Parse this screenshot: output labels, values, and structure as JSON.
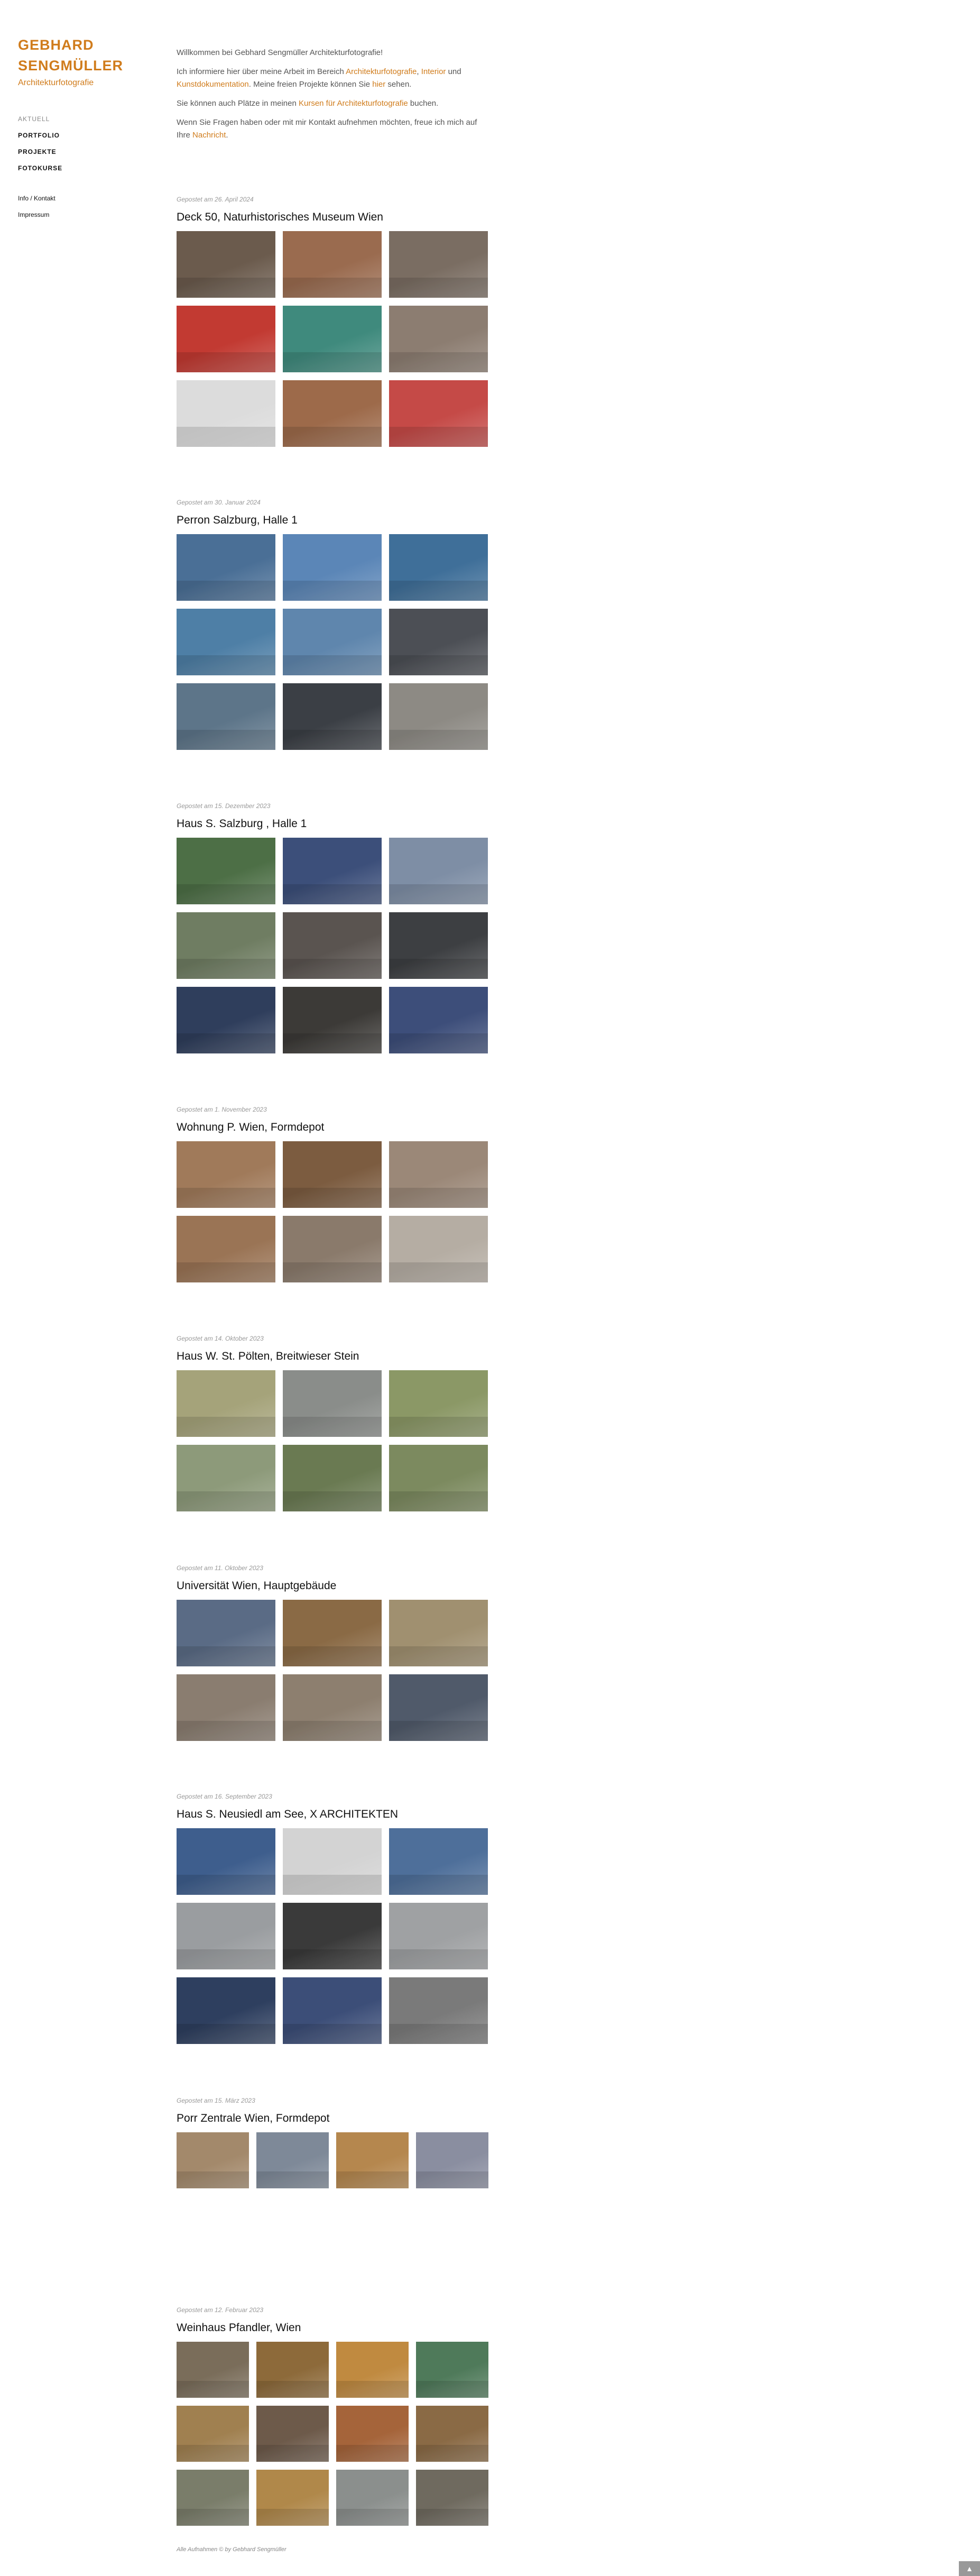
{
  "sidebar": {
    "logo_line1": "GEBHARD",
    "logo_line2": "SENGMÜLLER",
    "subtitle": "Architekturfotografie",
    "nav": [
      "AKTUELL",
      "PORTFOLIO",
      "PROJEKTE",
      "FOTOKURSE"
    ],
    "nav2": [
      "Info / Kontakt",
      "Impressum"
    ]
  },
  "intro": {
    "p1": "Willkommen bei Gebhard Sengmüller Architekturfotografie!",
    "p2_a": "Ich informiere hier über meine Arbeit im Bereich ",
    "p2_link1": "Architekturfotografie",
    "p2_b": ", ",
    "p2_link2": "Interior",
    "p2_c": " und ",
    "p2_link3": "Kunstdokumentation",
    "p2_d": ". Meine freien Projekte können Sie ",
    "p2_link4": "hier",
    "p2_e": " sehen.",
    "p3_a": "Sie können auch Plätze in meinen ",
    "p3_link": "Kursen für Architekturfotografie",
    "p3_b": " buchen.",
    "p4_a": "Wenn Sie Fragen haben oder mit mir Kontakt aufnehmen möchten, freue ich mich auf Ihre ",
    "p4_link": "Nachricht",
    "p4_b": "."
  },
  "posts": [
    {
      "date": "Gepostet am 26. April 2024",
      "title": "Deck 50, Naturhistorisches Museum Wien"
    },
    {
      "date": "Gepostet am 30. Januar 2024",
      "title": "Perron Salzburg, Halle 1"
    },
    {
      "date": "Gepostet am 15. Dezember 2023",
      "title": "Haus S. Salzburg , Halle 1"
    },
    {
      "date": "Gepostet am 1. November 2023",
      "title": "Wohnung P. Wien, Formdepot"
    },
    {
      "date": "Gepostet am 14. Oktober 2023",
      "title": "Haus W. St. Pölten, Breitwieser Stein"
    },
    {
      "date": "Gepostet am 11. Oktober 2023",
      "title": "Universität Wien, Hauptgebäude"
    },
    {
      "date": "Gepostet am 16. September 2023",
      "title": "Haus S. Neusiedl am See, X ARCHITEKTEN"
    },
    {
      "date": "Gepostet am 15. März 2023",
      "title": "Porr Zentrale Wien, Formdepot"
    },
    {
      "date": "Gepostet am 12. Februar 2023",
      "title": "Weinhaus Pfandler, Wien"
    }
  ],
  "tile_colors": {
    "deck": [
      "#6b5b4d",
      "#9a6b4f",
      "#7a6d62",
      "#c23a32",
      "#3f8a7d",
      "#8c7d71",
      "#dcdcdc",
      "#9d6a4a",
      "#c54a47"
    ],
    "perron": [
      "#4a6f96",
      "#5b86b7",
      "#3f6f99",
      "#4e7fa6",
      "#5f86ad",
      "#4c4f55",
      "#5d7589",
      "#3b3f45",
      "#8d8a84"
    ],
    "haus_s": [
      "#4d6f46",
      "#3c4f7a",
      "#7e8ea5",
      "#6f7d62",
      "#5a5450",
      "#3d3f42",
      "#2f3e5c",
      "#3c3a37",
      "#3d4e7a"
    ],
    "wohnung": [
      "#a07a5a",
      "#7c5c40",
      "#9b8878",
      "#9a7455",
      "#8a7a6b",
      "#b5ada3"
    ],
    "haus_w": [
      "#a5a37a",
      "#8a8d8a",
      "#8b9866",
      "#8d9a7a",
      "#6a7a52",
      "#7c8a5f"
    ],
    "uni": [
      "#5a6b85",
      "#8a6a45",
      "#a09070",
      "#8a7d70",
      "#8d7f6f",
      "#505a6a"
    ],
    "neusiedl": [
      "#3e5e8d",
      "#d3d3d3",
      "#4e6f9a",
      "#9a9da0",
      "#3a3a3a",
      "#9fa1a3",
      "#2e3f5f",
      "#3c4e78",
      "#7a7a7a"
    ],
    "porr": [
      "#a3896b",
      "#7e8998",
      "#b5874e",
      "#8a8ea0"
    ],
    "weinhaus": [
      "#7a6d5a",
      "#8d6a3a",
      "#c08a40",
      "#4f7a5a",
      "#a08050",
      "#6d5a4a",
      "#a5643a",
      "#8a6a45",
      "#7a7d6a",
      "#b0884a",
      "#8b8f8d",
      "#6f6a5f"
    ]
  },
  "footer": {
    "text": "Alle Aufnahmen © by Gebhard Sengmüller",
    "to_top": "▲"
  }
}
